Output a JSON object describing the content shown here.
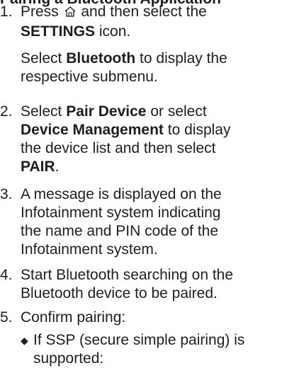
{
  "heading_partial": "Pairing a Bluetooth Application",
  "steps": [
    {
      "num": "1.",
      "l1_a": "Press",
      "l1_b": "and then select the",
      "l2_bold": "SETTINGS",
      "l2_rest": "icon.",
      "p2_a": "Select",
      "p2_bold": "Bluetooth",
      "p2_b": "to display the",
      "p2_c": "respective submenu."
    },
    {
      "num": "2.",
      "a": "Select",
      "bold1": "Pair Device",
      "b": "or select",
      "bold2": "Device Management",
      "c": "to display",
      "d": "the device list and then select",
      "bold3": "PAIR",
      "e": "."
    },
    {
      "num": "3.",
      "l1": "A message is displayed on the",
      "l2": "Infotainment system indicating",
      "l3": "the name and PIN code of the",
      "l4": "Infotainment system."
    },
    {
      "num": "4.",
      "l1": "Start Bluetooth searching on the",
      "l2": "Bluetooth device to be paired."
    },
    {
      "num": "5.",
      "l1": "Confirm pairing:",
      "bullet_l1": "If SSP (secure simple pairing) is",
      "bullet_l2": "supported:"
    }
  ],
  "icons": {
    "home": "home-icon",
    "bullet": "diamond-bullet-icon"
  }
}
